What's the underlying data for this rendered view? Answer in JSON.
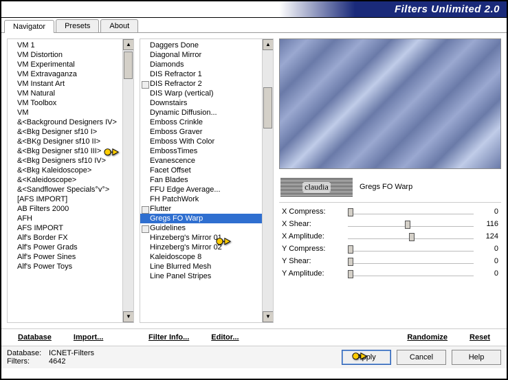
{
  "title": "Filters Unlimited 2.0",
  "tabs": [
    "Navigator",
    "Presets",
    "About"
  ],
  "active_tab": 0,
  "categories": [
    "VM 1",
    "VM Distortion",
    "VM Experimental",
    "VM Extravaganza",
    "VM Instant Art",
    "VM Natural",
    "VM Toolbox",
    "VM",
    "&<Background Designers IV>",
    "&<Bkg Designer sf10 I>",
    "&<BKg Designer sf10 II>",
    "&<Bkg Designer sf10 III>",
    "&<Bkg Designers sf10 IV>",
    "&<Bkg Kaleidoscope>",
    "&<Kaleidoscope>",
    "&<Sandflower Specials°v°>",
    "[AFS IMPORT]",
    "AB Filters 2000",
    "AFH",
    "AFS IMPORT",
    "Alf's Border FX",
    "Alf's Power Grads",
    "Alf's Power Sines",
    "Alf's Power Toys"
  ],
  "selected_category_index": 10,
  "filters": [
    {
      "name": "Daggers Done"
    },
    {
      "name": "Diagonal Mirror"
    },
    {
      "name": "Diamonds"
    },
    {
      "name": "DIS Refractor 1"
    },
    {
      "name": "DIS Refractor 2",
      "children": true
    },
    {
      "name": "DIS Warp (vertical)"
    },
    {
      "name": "Downstairs"
    },
    {
      "name": "Dynamic Diffusion..."
    },
    {
      "name": "Emboss Crinkle"
    },
    {
      "name": "Emboss Graver"
    },
    {
      "name": "Emboss With Color"
    },
    {
      "name": "EmbossTimes"
    },
    {
      "name": "Evanescence"
    },
    {
      "name": "Facet Offset"
    },
    {
      "name": "Fan Blades"
    },
    {
      "name": "FFU Edge Average..."
    },
    {
      "name": "FH PatchWork"
    },
    {
      "name": "Flutter",
      "children": true
    },
    {
      "name": "Gregs FO Warp"
    },
    {
      "name": "Guidelines",
      "children": true
    },
    {
      "name": "Hinzeberg's Mirror 01"
    },
    {
      "name": "Hinzeberg's Mirror 02"
    },
    {
      "name": "Kaleidoscope 8"
    },
    {
      "name": "Line Blurred Mesh"
    },
    {
      "name": "Line Panel Stripes"
    }
  ],
  "selected_filter_index": 18,
  "logo_text": "claudia",
  "filter_title": "Gregs FO Warp",
  "params": [
    {
      "label": "X Compress:",
      "value": 0,
      "max": 255
    },
    {
      "label": "X Shear:",
      "value": 116,
      "max": 255
    },
    {
      "label": "X Amplitude:",
      "value": 124,
      "max": 255
    },
    {
      "label": "Y Compress:",
      "value": 0,
      "max": 255
    },
    {
      "label": "Y Shear:",
      "value": 0,
      "max": 255
    },
    {
      "label": "Y Amplitude:",
      "value": 0,
      "max": 255
    }
  ],
  "links": {
    "database": "Database",
    "import": "Import...",
    "filter_info": "Filter Info...",
    "editor": "Editor...",
    "randomize": "Randomize",
    "reset": "Reset"
  },
  "status": {
    "db_label": "Database:",
    "db_value": "ICNET-Filters",
    "filters_label": "Filters:",
    "filters_value": "4642"
  },
  "buttons": {
    "apply": "Apply",
    "cancel": "Cancel",
    "help": "Help"
  }
}
